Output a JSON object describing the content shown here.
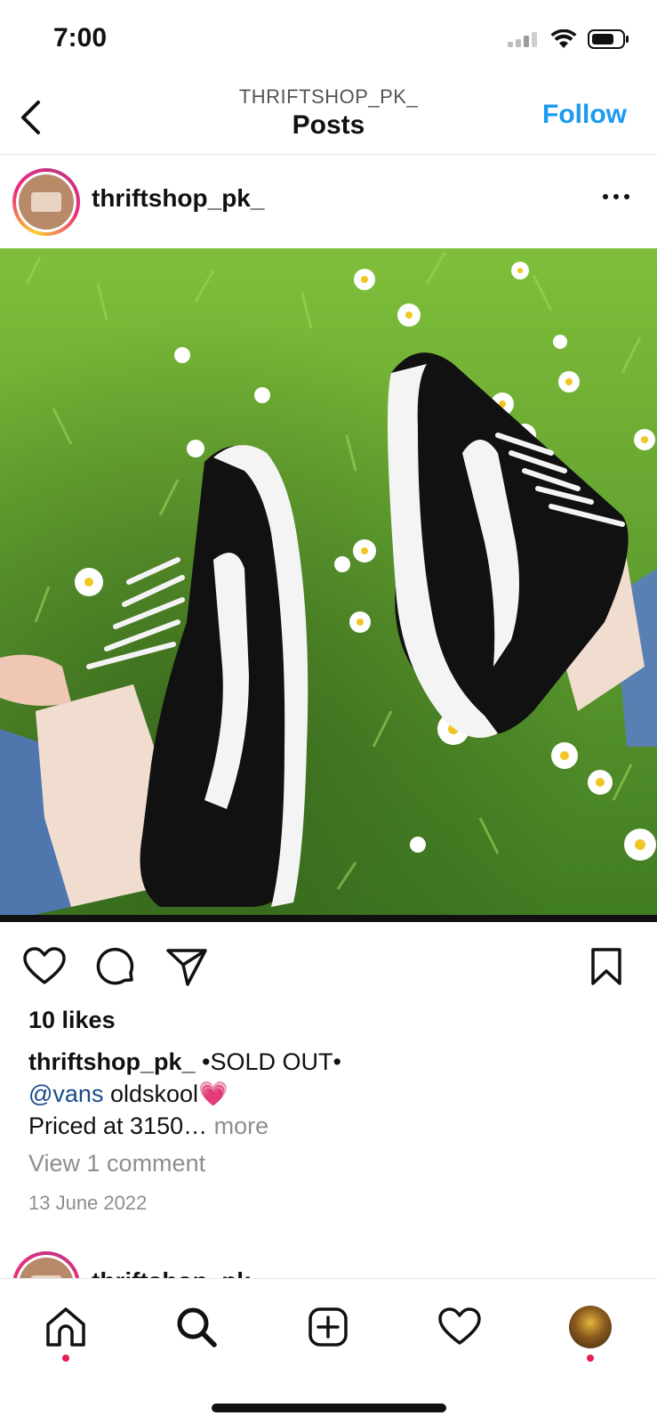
{
  "status_bar": {
    "time": "7:00",
    "icons": [
      "cellular-signal-icon",
      "wifi-icon",
      "battery-icon"
    ]
  },
  "header": {
    "subtitle": "THRIFTSHOP_PK_",
    "title": "Posts",
    "follow_label": "Follow"
  },
  "post": {
    "username": "thriftshop_pk_",
    "photo_description_icon": "post-photo",
    "likes": "10 likes",
    "caption_user": "thriftshop_pk_",
    "caption_line1": " •SOLD OUT•",
    "caption_mention": "@vans",
    "caption_line2": " oldskool💗",
    "caption_line3": "Priced at 3150…",
    "more_label": "more",
    "view_comments": "View 1 comment",
    "date": "13 June 2022"
  },
  "next_post": {
    "username": "thriftshop_pk_"
  },
  "tab_bar": {
    "tabs": [
      "home-icon",
      "search-icon",
      "create-icon",
      "activity-icon",
      "profile-avatar"
    ]
  },
  "colors": {
    "accent": "#1a9af0",
    "notification_dot": "#ed1c52",
    "mention": "#1b4a8a",
    "muted": "#8e8e8e"
  }
}
